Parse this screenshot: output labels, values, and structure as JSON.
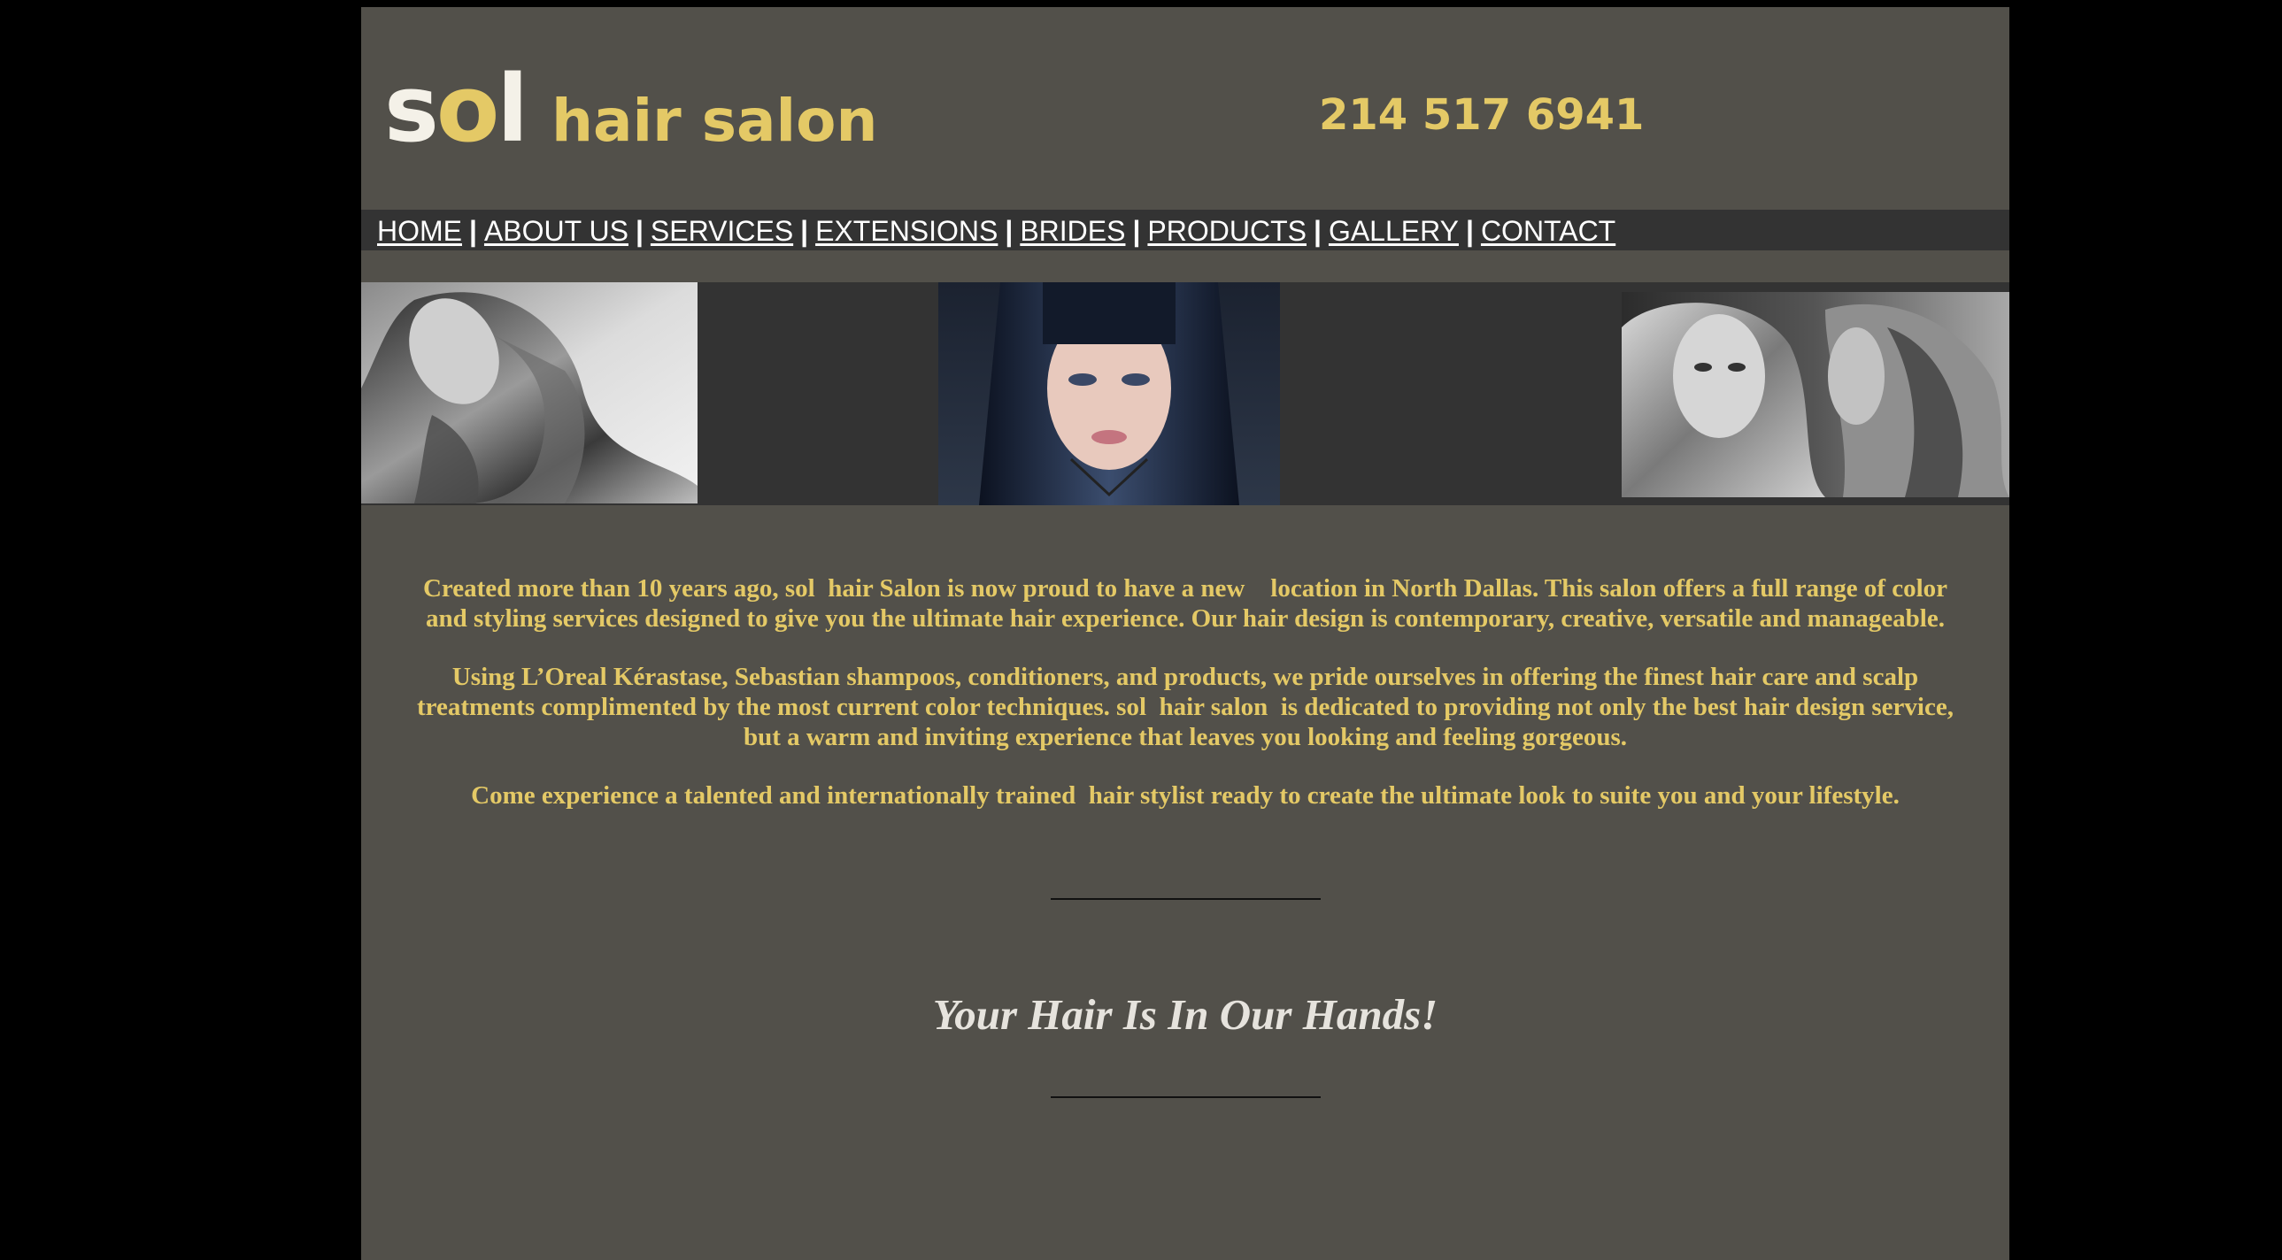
{
  "header": {
    "logo": {
      "s": "s",
      "o": "o",
      "l": "l",
      "tagline": "hair salon"
    },
    "phone": "214 517 6941"
  },
  "nav": {
    "items": [
      "HOME ",
      "ABOUT US",
      "SERVICES",
      " EXTENSIONS",
      " BRIDES",
      "PRODUCTS",
      "GALLERY",
      "CONTACT"
    ],
    "separator": "|"
  },
  "body": {
    "paragraph1_line1": "Created more than 10 years ago, sol  hair Salon is now proud to have a new    location in North Dallas. This salon offers a full range of color",
    "paragraph1_line2": "and styling services designed to give you the ultimate hair experience. Our hair design is contemporary, creative, versatile and manageable.",
    "paragraph2_line1": "Using L’Oreal Kérastase, Sebastian shampoos, conditioners, and products, we pride ourselves in offering the finest hair care and scalp",
    "paragraph2_line2": "treatments complimented by the most current color techniques. sol  hair salon  is dedicated to providing not only the best hair design service,",
    "paragraph2_line3": "but a warm and inviting experience that leaves you looking and feeling gorgeous.",
    "paragraph3": "Come experience a talented and internationally trained  hair stylist ready to create the ultimate look to suite you and your lifestyle.",
    "tagline": "Your Hair Is In Our Hands!"
  },
  "colors": {
    "page_bg": "#52504a",
    "outer_bg": "#000000",
    "accent": "#e4c966",
    "nav_bg": "#333333"
  }
}
